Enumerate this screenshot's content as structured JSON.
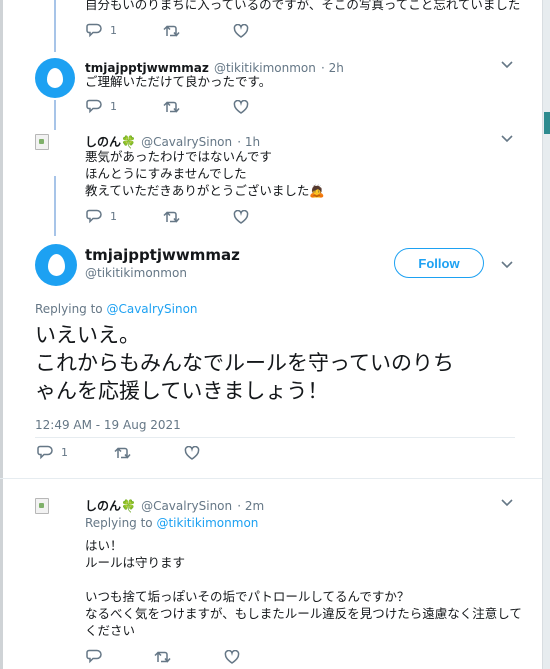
{
  "tweets": [
    {
      "text_lines": [
        "自分もいのりまちに入っているのですが、そこの写真ってこと忘れていました"
      ],
      "reply_count": "1"
    },
    {
      "name": "tmjajpptjwwmmaz",
      "handle": "@tikitikimonmon",
      "time": "2h",
      "text_lines": [
        "ご理解いただけて良かったです。"
      ],
      "reply_count": "1"
    },
    {
      "name": "しのん",
      "name_emoji": "🍀",
      "handle": "@CavalrySinon",
      "time": "1h",
      "text_lines": [
        "悪気があったわけではないんです",
        "ほんとうにすみませんでした",
        "教えていただきありがとうございました🙇"
      ],
      "reply_count": "1"
    }
  ],
  "main_tweet": {
    "name": "tmjajpptjwwmmaz",
    "handle": "@tikitikimonmon",
    "follow_label": "Follow",
    "replying_prefix": "Replying to ",
    "replying_to": "@CavalrySinon",
    "text_lines": [
      "いえいえ。",
      "これからもみんなでルールを守っていのりち",
      "ゃんを応援していきましょう！"
    ],
    "timestamp": "12:49 AM - 19 Aug 2021",
    "reply_count": "1"
  },
  "reply": {
    "name": "しのん",
    "name_emoji": "🍀",
    "handle": "@CavalrySinon",
    "time": "2m",
    "replying_prefix": "Replying to ",
    "replying_to": "@tikitikimonmon",
    "text_lines": [
      "はい！",
      "ルールは守ります",
      "",
      "いつも捨て垢っぽいその垢でパトロールしてるんですか？",
      "なるべく気をつけますが、もしまたルール違反を見つけたら遠慮なく注意して",
      "ください"
    ]
  },
  "icons": {
    "reply": "reply-icon",
    "retweet": "retweet-icon",
    "like": "heart-icon",
    "caret": "chevron-down-icon"
  },
  "colors": {
    "accent": "#1da1f2",
    "muted": "#657786",
    "thread_line": "#a7c4e8"
  }
}
